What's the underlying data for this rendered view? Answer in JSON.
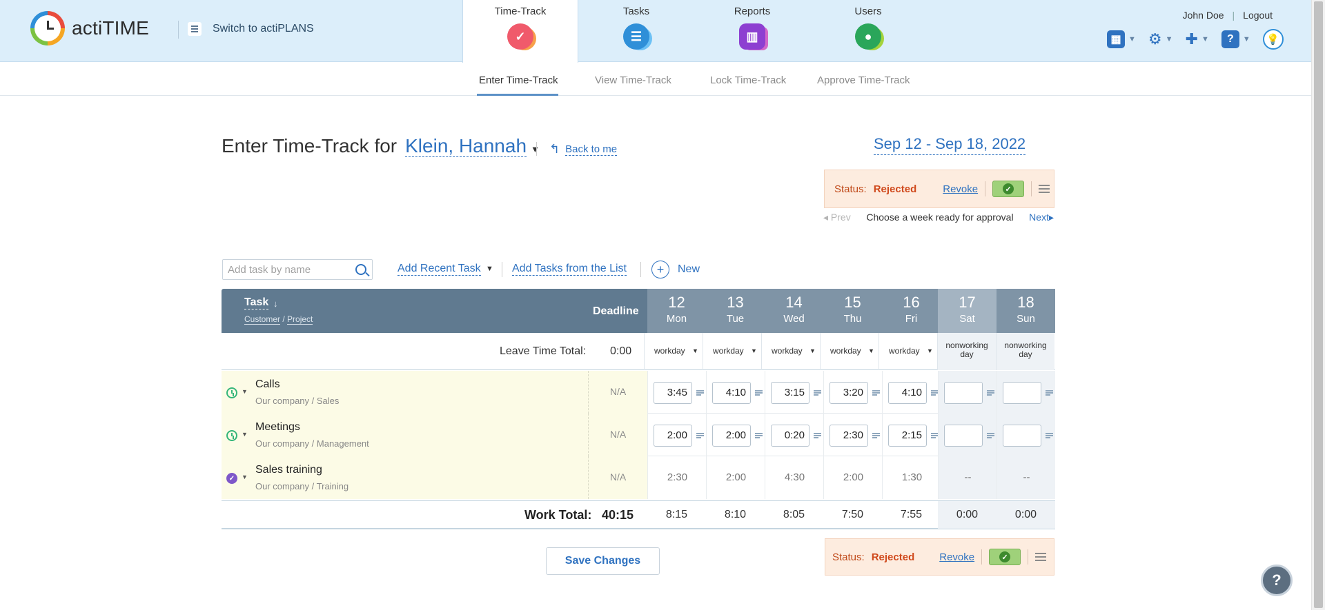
{
  "app": {
    "logo_text": "actiTIME",
    "switch_label": "Switch to actiPLANS"
  },
  "nav": {
    "tabs": [
      {
        "label": "Time-Track",
        "icon": "checkmark-icon",
        "color": "#f05a6b"
      },
      {
        "label": "Tasks",
        "icon": "list-icon",
        "color": "#2f8fd8"
      },
      {
        "label": "Reports",
        "icon": "bar-chart-icon",
        "color": "#8d3fd1"
      },
      {
        "label": "Users",
        "icon": "user-icon",
        "color": "#2aa65a"
      }
    ],
    "active_tab": "Time-Track"
  },
  "user": {
    "name": "John Doe",
    "logout_label": "Logout"
  },
  "toolbar_icons": [
    "calendar-icon",
    "gear-icon",
    "puzzle-icon",
    "help-icon",
    "lightbulb-icon"
  ],
  "subnav": {
    "items": [
      "Enter Time-Track",
      "View Time-Track",
      "Lock Time-Track",
      "Approve Time-Track"
    ],
    "active": "Enter Time-Track"
  },
  "page": {
    "title_prefix": "Enter Time-Track for",
    "person": "Klein, Hannah",
    "back_label": "Back to me",
    "week_range": "Sep 12 - Sep 18, 2022"
  },
  "status": {
    "label": "Status:",
    "value": "Rejected",
    "revoke": "Revoke",
    "status_color": "#d0491c"
  },
  "week_nav": {
    "prev": "Prev",
    "message": "Choose a week ready for approval",
    "next": "Next"
  },
  "task_toolbar": {
    "search_placeholder": "Add task by name",
    "add_recent": "Add Recent Task",
    "add_from_list": "Add Tasks from the List",
    "new_label": "New"
  },
  "table": {
    "header": {
      "task": "Task",
      "customer": "Customer",
      "slash": "/",
      "project": "Project",
      "deadline": "Deadline"
    },
    "days": [
      {
        "num": "12",
        "wd": "Mon",
        "type": "workday"
      },
      {
        "num": "13",
        "wd": "Tue",
        "type": "workday"
      },
      {
        "num": "14",
        "wd": "Wed",
        "type": "workday"
      },
      {
        "num": "15",
        "wd": "Thu",
        "type": "workday"
      },
      {
        "num": "16",
        "wd": "Fri",
        "type": "workday"
      },
      {
        "num": "17",
        "wd": "Sat",
        "type": "nonworking day"
      },
      {
        "num": "18",
        "wd": "Sun",
        "type": "nonworking day"
      }
    ],
    "leave_label": "Leave Time Total:",
    "leave_total": "0:00",
    "rows": [
      {
        "name": "Calls",
        "customer": "Our company",
        "project": "Sales",
        "deadline": "N/A",
        "status": "open",
        "values": [
          "3:45",
          "4:10",
          "3:15",
          "3:20",
          "4:10",
          "",
          ""
        ]
      },
      {
        "name": "Meetings",
        "customer": "Our company",
        "project": "Management",
        "deadline": "N/A",
        "status": "open",
        "values": [
          "2:00",
          "2:00",
          "0:20",
          "2:30",
          "2:15",
          "",
          ""
        ]
      },
      {
        "name": "Sales training",
        "customer": "Our company",
        "project": "Training",
        "deadline": "N/A",
        "status": "completed",
        "values": [
          "2:30",
          "2:00",
          "4:30",
          "2:00",
          "1:30",
          "--",
          "--"
        ]
      }
    ],
    "work_total_label": "Work Total:",
    "work_total": "40:15",
    "day_totals": [
      "8:15",
      "8:10",
      "8:05",
      "7:50",
      "7:55",
      "0:00",
      "0:00"
    ]
  },
  "save_label": "Save Changes",
  "help_label": "?"
}
